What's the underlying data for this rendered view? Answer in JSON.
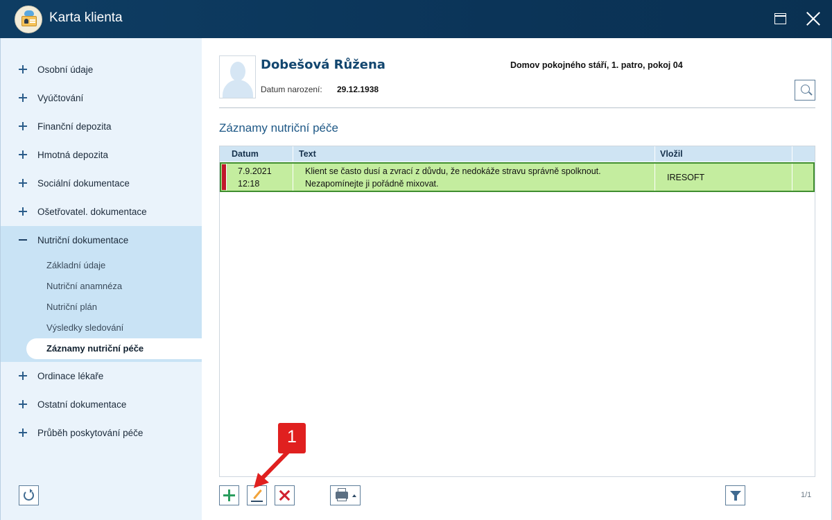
{
  "window": {
    "title": "Karta klienta"
  },
  "sidebar": {
    "items": [
      {
        "label": "Osobní údaje"
      },
      {
        "label": "Vyúčtování"
      },
      {
        "label": "Finanční depozita"
      },
      {
        "label": "Hmotná depozita"
      },
      {
        "label": "Sociální dokumentace"
      },
      {
        "label": "Ošetřovatel. dokumentace"
      },
      {
        "label": "Nutriční dokumentace",
        "expanded": true
      },
      {
        "label": "Ordinace lékaře"
      },
      {
        "label": "Ostatní dokumentace"
      },
      {
        "label": "Průběh poskytování péče"
      }
    ],
    "subitems": [
      {
        "label": "Základní údaje"
      },
      {
        "label": "Nutriční anamnéza"
      },
      {
        "label": "Nutriční plán"
      },
      {
        "label": "Výsledky sledování"
      },
      {
        "label": "Záznamy nutriční péče",
        "active": true
      }
    ]
  },
  "client": {
    "name": "Dobešová Růžena",
    "dob_label": "Datum narození:",
    "dob": "29.12.1938",
    "location": "Domov pokojného stáří, 1. patro, pokoj 04"
  },
  "section": {
    "title": "Záznamy nutriční péče"
  },
  "grid": {
    "columns": [
      "Datum",
      "Text",
      "Vložil"
    ],
    "rows": [
      {
        "date": "7.9.2021",
        "time": "12:18",
        "text_line1": "Klient se často dusí a zvrací z důvdu, že nedokáže stravu správně spolknout.",
        "text_line2": "Nezapomínejte ji pořádně mixovat.",
        "author": "IRESOFT",
        "selected": true
      }
    ]
  },
  "pager": "1/1",
  "annotation": {
    "number": "1"
  },
  "colors": {
    "titlebar": "#0e3d63",
    "selected_row": "#c4ed9f",
    "row_marker": "#c0182a",
    "accent": "#1e5886"
  }
}
